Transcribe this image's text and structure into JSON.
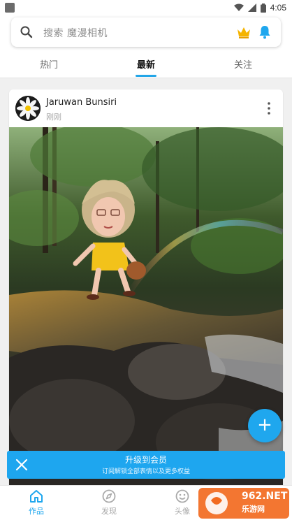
{
  "status_bar": {
    "time": "4:05"
  },
  "search": {
    "placeholder": "搜索 魔漫相机"
  },
  "tabs": [
    {
      "label": "热门",
      "active": false
    },
    {
      "label": "最新",
      "active": true
    },
    {
      "label": "关注",
      "active": false
    }
  ],
  "post": {
    "user_name": "Jaruwan Bunsiri",
    "time": "刚刚"
  },
  "vip_banner": {
    "title": "升级到会员",
    "subtitle": "订阅解锁全部表情以及更多权益"
  },
  "bottom_nav": [
    {
      "label": "作品",
      "icon": "home-icon",
      "active": true
    },
    {
      "label": "发现",
      "icon": "compass-icon",
      "active": false
    },
    {
      "label": "头像",
      "icon": "smiley-icon",
      "active": false
    }
  ],
  "watermark": {
    "brand": "962.NET",
    "sub": "乐游网"
  },
  "colors": {
    "accent": "#1fa7ee",
    "crown": "#f5b400"
  }
}
